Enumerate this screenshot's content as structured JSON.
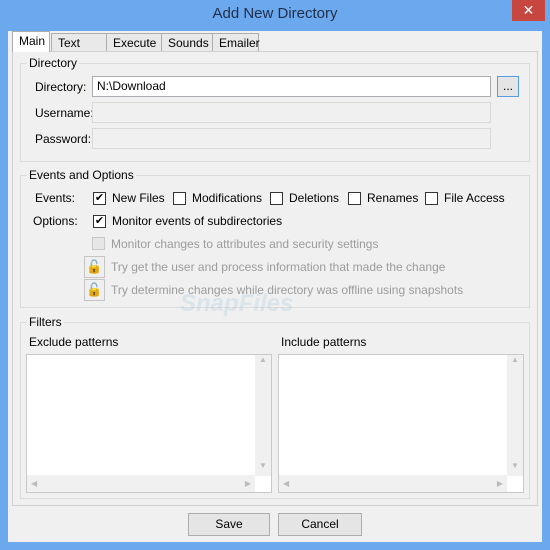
{
  "window": {
    "title": "Add New Directory",
    "close": "✕"
  },
  "tabs": [
    "Main",
    "Text Log",
    "Execute",
    "Sounds",
    "Emailer"
  ],
  "directory_group": {
    "label": "Directory",
    "directory_label": "Directory:",
    "directory_value": "N:\\Download",
    "browse": "...",
    "username_label": "Username:",
    "username_value": "",
    "password_label": "Password:",
    "password_value": ""
  },
  "events_group": {
    "label": "Events and Options",
    "events_label": "Events:",
    "events": [
      {
        "label": "New Files",
        "checked": true
      },
      {
        "label": "Modifications",
        "checked": false
      },
      {
        "label": "Deletions",
        "checked": false
      },
      {
        "label": "Renames",
        "checked": false
      },
      {
        "label": "File Access",
        "checked": false
      }
    ],
    "options_label": "Options:",
    "monitor_sub": "Monitor events of subdirectories",
    "monitor_attr": "Monitor changes to attributes and security settings",
    "try_user": "Try get the user and process information that made the change",
    "try_offline": "Try determine changes while directory was offline using snapshots"
  },
  "filters_group": {
    "label": "Filters",
    "exclude": "Exclude patterns",
    "include": "Include patterns"
  },
  "buttons": {
    "save": "Save",
    "cancel": "Cancel"
  },
  "watermark": "SnapFiles"
}
